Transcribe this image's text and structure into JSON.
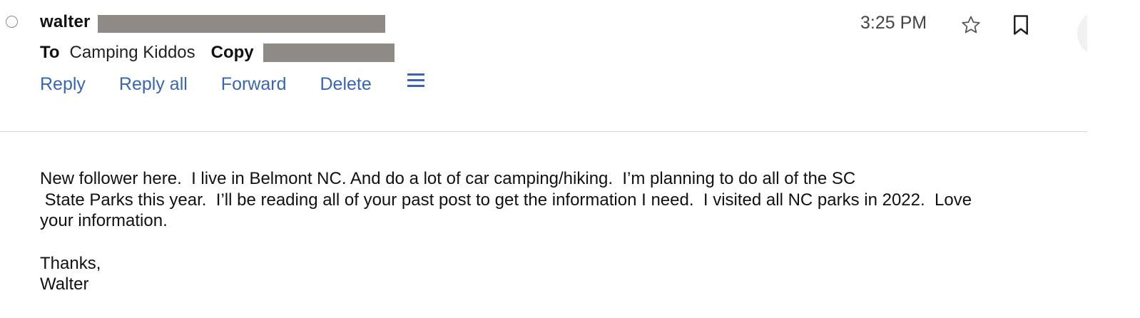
{
  "message": {
    "sender_name": "walter",
    "to_label": "To",
    "to_value": "Camping Kiddos",
    "copy_label": "Copy",
    "time": "3:25 PM"
  },
  "actions": {
    "reply": "Reply",
    "reply_all": "Reply all",
    "forward": "Forward",
    "delete": "Delete"
  },
  "icons": {
    "star": "star-icon",
    "bookmark": "bookmark-icon",
    "menu": "menu-icon"
  },
  "colors": {
    "link": "#3866b5",
    "redaction": "#8f8a86",
    "divider": "#d6d6d6"
  },
  "body": {
    "line1": "New follower here.  I live in Belmont NC. And do a lot of car camping/hiking.  I’m planning to do all of the SC",
    "line2": " State Parks this year.  I’ll be reading all of your past post to get the information I need.  I visited all NC parks in 2022.  Love",
    "line3": "your information.",
    "sign_thanks": "Thanks,",
    "sign_name": "Walter"
  }
}
